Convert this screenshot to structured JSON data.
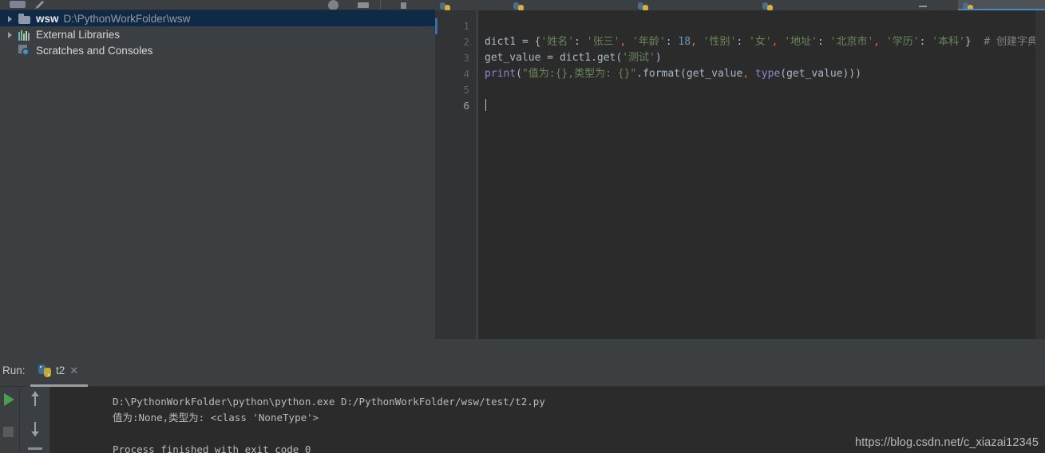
{
  "toolbar": {
    "icons": [
      "window-icon",
      "pencil-icon",
      "help-circle-icon",
      "monitor-icon",
      "separator",
      "dot-icon"
    ]
  },
  "editor_tabs": {
    "tabs": [
      {
        "label": "",
        "icon": "python-file-icon",
        "active": false
      },
      {
        "label": "",
        "icon": "python-file-icon",
        "active": false
      },
      {
        "label": "",
        "icon": "python-file-icon",
        "active": false
      },
      {
        "label": "",
        "icon": "python-file-icon",
        "active": false
      },
      {
        "label": "",
        "icon": "python-file-icon",
        "active": true
      }
    ],
    "accent_color": "#4a88c7"
  },
  "sidebar": {
    "items": [
      {
        "label": "wsw",
        "path": "D:\\PythonWorkFolder\\wsw",
        "icon": "folder-icon",
        "arrow": "closed",
        "selected": true
      },
      {
        "label": "External Libraries",
        "path": "",
        "icon": "libraries-icon",
        "arrow": "closed",
        "selected": false
      },
      {
        "label": "Scratches and Consoles",
        "path": "",
        "icon": "scratches-icon",
        "arrow": "none",
        "selected": false
      }
    ],
    "selection_color": "#0e2a47"
  },
  "editor": {
    "line_numbers": [
      "1",
      "2",
      "3",
      "4",
      "5",
      "6"
    ],
    "current_line": 6,
    "lines": [
      {
        "n": 1,
        "segments": []
      },
      {
        "n": 2,
        "segments": [
          {
            "t": "dict1 ",
            "c": "tok-punc"
          },
          {
            "t": "= ",
            "c": "tok-punc"
          },
          {
            "t": "{",
            "c": "tok-brace"
          },
          {
            "t": "'姓名'",
            "c": "tok-str"
          },
          {
            "t": ":",
            "c": "tok-punc"
          },
          {
            "t": " ",
            "c": "tok-punc"
          },
          {
            "t": "'张三'",
            "c": "tok-str"
          },
          {
            "t": ",",
            "c": "tok-comma"
          },
          {
            "t": " ",
            "c": "tok-punc"
          },
          {
            "t": "'年龄'",
            "c": "tok-str"
          },
          {
            "t": ":",
            "c": "tok-punc"
          },
          {
            "t": " ",
            "c": "tok-punc"
          },
          {
            "t": "18",
            "c": "tok-num"
          },
          {
            "t": ",",
            "c": "tok-comma"
          },
          {
            "t": " ",
            "c": "tok-punc"
          },
          {
            "t": "'性别'",
            "c": "tok-str"
          },
          {
            "t": ":",
            "c": "tok-punc"
          },
          {
            "t": " ",
            "c": "tok-punc"
          },
          {
            "t": "'女'",
            "c": "tok-str"
          },
          {
            "t": ",",
            "c": "tok-comma"
          },
          {
            "t": " ",
            "c": "tok-punc"
          },
          {
            "t": "'地址'",
            "c": "tok-str"
          },
          {
            "t": ":",
            "c": "tok-punc"
          },
          {
            "t": " ",
            "c": "tok-punc"
          },
          {
            "t": "'北京市'",
            "c": "tok-str"
          },
          {
            "t": ",",
            "c": "tok-comma"
          },
          {
            "t": " ",
            "c": "tok-punc"
          },
          {
            "t": "'学历'",
            "c": "tok-str"
          },
          {
            "t": ":",
            "c": "tok-punc"
          },
          {
            "t": " ",
            "c": "tok-punc"
          },
          {
            "t": "'本科'",
            "c": "tok-str"
          },
          {
            "t": "}",
            "c": "tok-brace"
          },
          {
            "t": "  ",
            "c": "tok-punc"
          },
          {
            "t": "# 创建字典",
            "c": "tok-cmt"
          }
        ]
      },
      {
        "n": 3,
        "segments": [
          {
            "t": "get_value ",
            "c": "tok-punc"
          },
          {
            "t": "= ",
            "c": "tok-punc"
          },
          {
            "t": "dict1",
            "c": "tok-punc"
          },
          {
            "t": ".get(",
            "c": "tok-punc"
          },
          {
            "t": "'测试'",
            "c": "tok-str"
          },
          {
            "t": ")",
            "c": "tok-punc"
          }
        ]
      },
      {
        "n": 4,
        "segments": [
          {
            "t": "print",
            "c": "tok-fn"
          },
          {
            "t": "(",
            "c": "tok-punc"
          },
          {
            "t": "\"值为:{},类型为: {}\"",
            "c": "tok-str"
          },
          {
            "t": ".format(get_value",
            "c": "tok-punc"
          },
          {
            "t": ",",
            "c": "tok-comma"
          },
          {
            "t": " ",
            "c": "tok-punc"
          },
          {
            "t": "type",
            "c": "tok-fn"
          },
          {
            "t": "(get_value)))",
            "c": "tok-punc"
          }
        ]
      },
      {
        "n": 5,
        "segments": []
      },
      {
        "n": 6,
        "segments": [],
        "caret": true
      }
    ]
  },
  "run_panel": {
    "label": "Run:",
    "tab_name": "t2",
    "tab_icon": "python-logo-icon",
    "close_glyph": "✕",
    "controls": [
      "run-button",
      "stop-button",
      "scroll-up-button",
      "scroll-down-button",
      "soft-wrap-button"
    ],
    "console_lines": [
      "D:\\PythonWorkFolder\\python\\python.exe D:/PythonWorkFolder/wsw/test/t2.py",
      "值为:None,类型为: <class 'NoneType'>",
      "",
      "Process finished with exit code 0"
    ]
  },
  "watermark": {
    "text": "https://blog.csdn.net/c_xiazai12345"
  }
}
